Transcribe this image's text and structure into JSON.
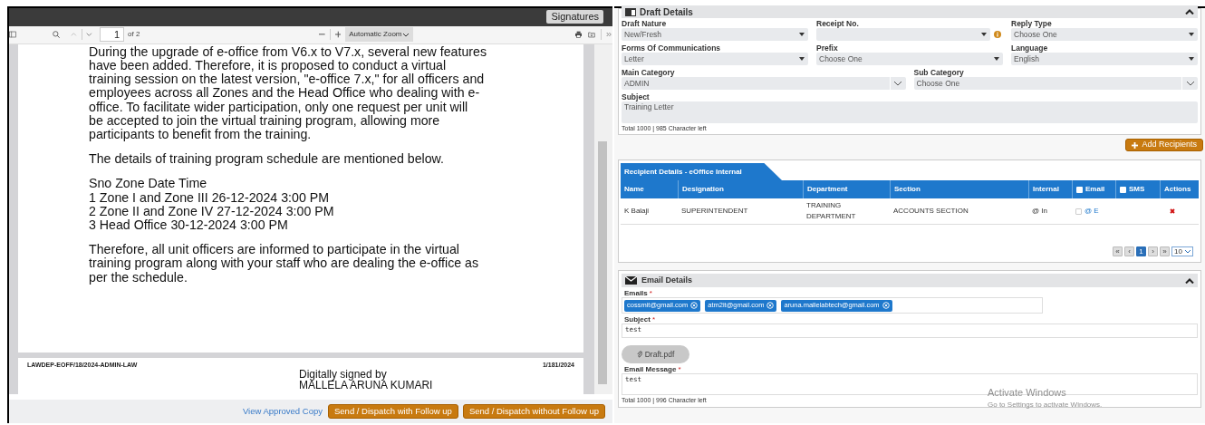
{
  "pdf_viewer": {
    "signatures_button": "Signatures",
    "page_number": "1",
    "page_count": "of 2",
    "zoom": "Automatic Zoom",
    "paragraphs": [
      [
        "During the upgrade of e-office from V6.x to V7.x, several new features",
        "have been added. Therefore, it is proposed to conduct a virtual",
        "training session on the latest version, \"e-office 7.x,\" for all officers and",
        "employees across all Zones and the Head Office who dealing with e-",
        "office. To facilitate wider participation, only one request per unit will",
        "be accepted to join the virtual training program, allowing more",
        "participants to benefit from the training."
      ],
      [
        "The details of training program schedule are mentioned below."
      ],
      [
        "Sno Zone Date Time",
        "1 Zone I and Zone III 26-12-2024 3:00 PM",
        "2 Zone II and Zone IV 27-12-2024 3:00 PM",
        "3 Head Office 30-12-2024 3:00 PM"
      ],
      [
        "Therefore, all unit officers are informed to participate in the virtual",
        "training program along with your staff who are dealing the e-office as",
        "per the schedule."
      ]
    ],
    "page2_ref": "LAWDEP-EOFF/18/2024-ADMIN-LAW",
    "page2_number": "1/181/2024",
    "signature_lines": [
      "Digitally signed by",
      "MALLELA ARUNA KUMARI"
    ]
  },
  "footer": {
    "link": "View Approved Copy",
    "buttons": [
      "Send / Dispatch with Follow up",
      "Send / Dispatch without Follow up"
    ]
  },
  "draft_details": {
    "title": "Draft Details",
    "expanded": true,
    "field_rows": [
      [
        {
          "label": "Draft Nature",
          "value": "New/Fresh",
          "kind": "select"
        },
        {
          "label": "Receipt No.",
          "kind": "select-info"
        },
        {
          "label": "Reply Type",
          "value": "Choose One",
          "kind": "select"
        }
      ],
      [
        {
          "label": "Forms Of Communications",
          "value": "Letter",
          "kind": "select"
        },
        {
          "label": "Prefix",
          "value": "Choose One",
          "kind": "select"
        },
        {
          "label": "Language",
          "value": "English",
          "kind": "select"
        }
      ],
      [
        {
          "label": "Main Category",
          "value": "ADMIN",
          "kind": "combo"
        },
        {
          "label": "Sub Category",
          "value": "Choose One",
          "kind": "combo"
        }
      ]
    ],
    "subject": {
      "label": "Subject",
      "value": "Training Letter"
    },
    "counter": "Total 1000 | 985 Character left"
  },
  "add_recipients_button": "Add Recipients",
  "recipients": {
    "tab": "Recipient Details - eOffice Internal",
    "columns": [
      {
        "label": "Name",
        "kind": "plain"
      },
      {
        "label": "Designation",
        "kind": "plain"
      },
      {
        "label": "Department",
        "kind": "plain"
      },
      {
        "label": "Section",
        "kind": "plain"
      },
      {
        "label": "Internal",
        "kind": "plain"
      },
      {
        "label": "Email",
        "kind": "checkbox",
        "checked": false
      },
      {
        "label": "SMS",
        "kind": "checkbox",
        "checked": false
      },
      {
        "label": "Actions",
        "kind": "plain"
      }
    ],
    "rows": [
      {
        "name": "K Balaji",
        "designation": "SUPERINTENDENT",
        "department": "TRAINING DEPARTMENT",
        "section": "ACCOUNTS SECTION",
        "internal": "@ In",
        "email_checked": false,
        "email": "@ E"
      }
    ],
    "pagination": {
      "first": "«",
      "prev": "‹",
      "pages": [
        {
          "label": "1",
          "selected": true
        }
      ],
      "next": "›",
      "last": "»",
      "page_size": "10"
    }
  },
  "email_details": {
    "title": "Email Details",
    "expanded": true,
    "emails_label": {
      "text": "Emails",
      "required_mark": "*"
    },
    "emails": [
      "cossmit@gmail.com",
      "atm2it@gmail.com",
      "aruna.mallelabtech@gmail.com"
    ],
    "subject_label": {
      "text": "Subject",
      "required_mark": "*"
    },
    "subject": "test",
    "attachment": "Draft.pdf",
    "message_label": {
      "text": "Email Message",
      "required_mark": "*"
    },
    "message": "test",
    "counter": "Total 1000 | 996 Character left"
  },
  "os_notice": {
    "title": "Activate Windows",
    "text": "Go to Settings to activate Windows."
  }
}
